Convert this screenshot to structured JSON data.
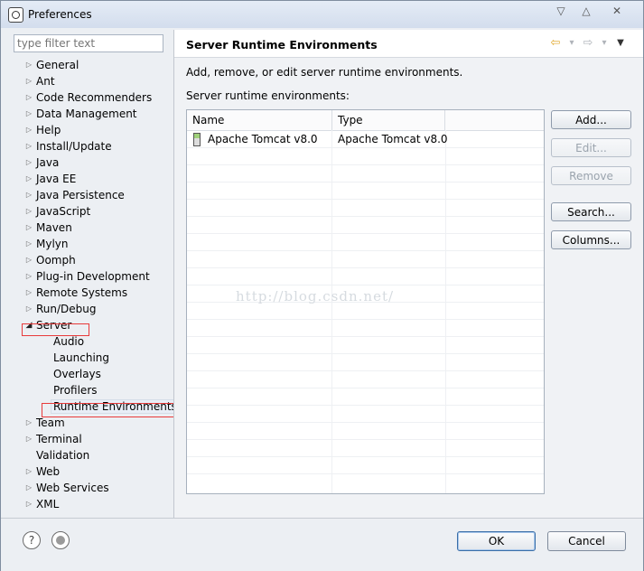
{
  "window": {
    "title": "Preferences",
    "minimize_glyph": "▽",
    "maximize_glyph": "△",
    "close_glyph": "✕"
  },
  "filter": {
    "placeholder": "type filter text"
  },
  "tree": {
    "items": [
      {
        "label": "General",
        "expandable": true
      },
      {
        "label": "Ant",
        "expandable": true
      },
      {
        "label": "Code Recommenders",
        "expandable": true
      },
      {
        "label": "Data Management",
        "expandable": true
      },
      {
        "label": "Help",
        "expandable": true
      },
      {
        "label": "Install/Update",
        "expandable": true
      },
      {
        "label": "Java",
        "expandable": true
      },
      {
        "label": "Java EE",
        "expandable": true
      },
      {
        "label": "Java Persistence",
        "expandable": true
      },
      {
        "label": "JavaScript",
        "expandable": true
      },
      {
        "label": "Maven",
        "expandable": true
      },
      {
        "label": "Mylyn",
        "expandable": true
      },
      {
        "label": "Oomph",
        "expandable": true
      },
      {
        "label": "Plug-in Development",
        "expandable": true
      },
      {
        "label": "Remote Systems",
        "expandable": true
      },
      {
        "label": "Run/Debug",
        "expandable": true
      },
      {
        "label": "Server",
        "expandable": true,
        "expanded": true
      },
      {
        "label": "Audio",
        "child": true
      },
      {
        "label": "Launching",
        "child": true
      },
      {
        "label": "Overlays",
        "child": true
      },
      {
        "label": "Profilers",
        "child": true
      },
      {
        "label": "Runtime Environments",
        "child": true,
        "selected": true
      },
      {
        "label": "Team",
        "expandable": true
      },
      {
        "label": "Terminal",
        "expandable": true
      },
      {
        "label": "Validation",
        "expandable": false
      },
      {
        "label": "Web",
        "expandable": true
      },
      {
        "label": "Web Services",
        "expandable": true
      },
      {
        "label": "XML",
        "expandable": true
      }
    ]
  },
  "page": {
    "title": "Server Runtime Environments",
    "description": "Add, remove, or edit server runtime environments.",
    "list_label": "Server runtime environments:",
    "nav": {
      "back_glyph": "⇦",
      "forward_glyph": "⇨",
      "dropdown_glyph": "▾",
      "menu_glyph": "▼"
    }
  },
  "table": {
    "columns": [
      "Name",
      "Type"
    ],
    "rows": [
      {
        "name": "Apache Tomcat v8.0",
        "type": "Apache Tomcat v8.0"
      }
    ]
  },
  "buttons": {
    "add": "Add...",
    "edit": "Edit...",
    "remove": "Remove",
    "search": "Search...",
    "columns": "Columns..."
  },
  "watermark": "http://blog.csdn.net/",
  "footer": {
    "help_glyph": "?",
    "ok": "OK",
    "cancel": "Cancel"
  },
  "colors": {
    "highlight_box": "#e83a3a",
    "nav_back_arrow": "#e0a82e"
  }
}
